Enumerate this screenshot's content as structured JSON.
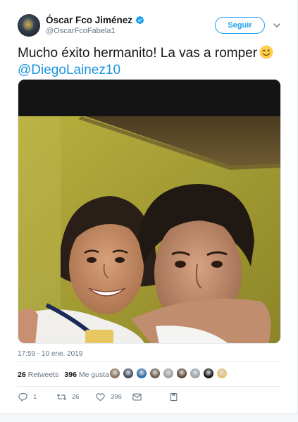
{
  "user": {
    "name": "Óscar Fco Jiménez",
    "handle": "@OscarFcoFabela1",
    "verified": true
  },
  "header": {
    "follow_label": "Seguir"
  },
  "tweet": {
    "text": "Mucho éxito hermanito! La vas a romper",
    "emoji": "wink-emoji",
    "mention": "@DiegoLainez10",
    "timestamp": "17:59 - 10 ene. 2019"
  },
  "stats": {
    "retweets_count": "26",
    "retweets_label": "Retweets",
    "likes_count": "396",
    "likes_label": "Me gusta",
    "liker_avatar_colors": [
      "#8a6f5c",
      "#3d4b5c",
      "#2c6fa8",
      "#6b5a4a",
      "#a0a0a0",
      "#5c4633",
      "#9aa3ab",
      "#111111",
      "#e8c070"
    ]
  },
  "actions": {
    "reply_count": "1",
    "retweet_count": "26",
    "like_count": "396"
  },
  "colors": {
    "accent": "#1da1f2",
    "mention": "#1b95e0",
    "secondary_text": "#657786"
  }
}
